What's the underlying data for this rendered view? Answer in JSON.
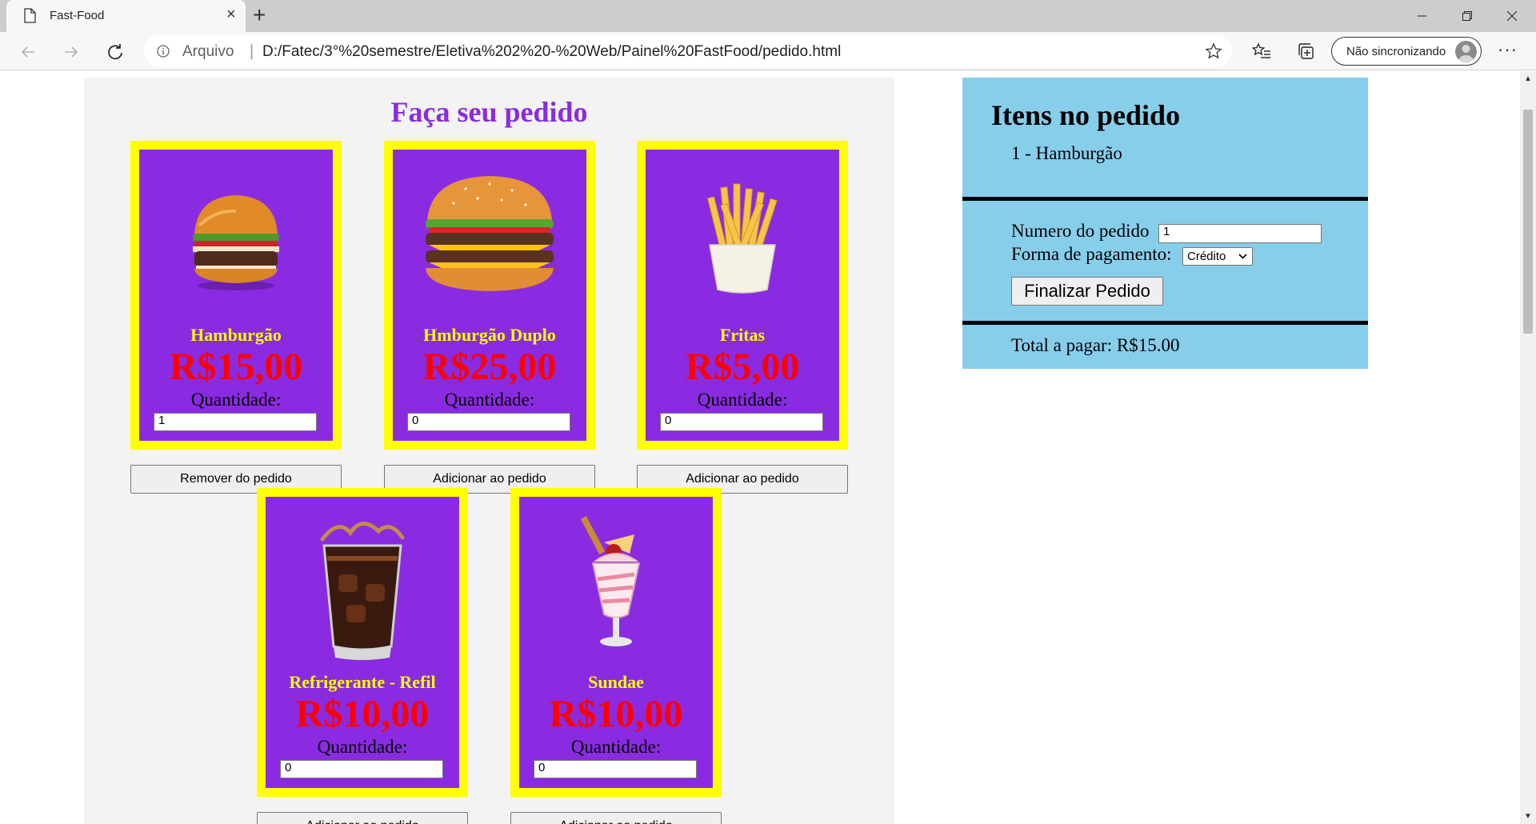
{
  "browser": {
    "tab_title": "Fast-Food",
    "address_label": "Arquivo",
    "address_separator": "|",
    "url": "D:/Fatec/3°%20semestre/Eletiva%202%20-%20Web/Painel%20FastFood/pedido.html",
    "profile_label": "Não sincronizando",
    "more_label": "···",
    "new_tab_label": "+",
    "close_tab_label": "×"
  },
  "menu": {
    "title": "Faça seu pedido",
    "quantity_label": "Quantidade:",
    "items": [
      {
        "name": "Hamburgão",
        "price": "R$15,00",
        "quantity": "1",
        "button": "Remover do pedido",
        "icon": "burger-icon"
      },
      {
        "name": "Hmburgão Duplo",
        "price": "R$25,00",
        "quantity": "0",
        "button": "Adicionar ao pedido",
        "icon": "double-burger-icon"
      },
      {
        "name": "Fritas",
        "price": "R$5,00",
        "quantity": "0",
        "button": "Adicionar ao pedido",
        "icon": "fries-icon"
      },
      {
        "name": "Refrigerante - Refil",
        "price": "R$10,00",
        "quantity": "0",
        "button": "Adicionar ao pedido",
        "icon": "soda-glass-icon"
      },
      {
        "name": "Sundae",
        "price": "R$10,00",
        "quantity": "0",
        "button": "Adicionar ao pedido",
        "icon": "sundae-icon"
      }
    ]
  },
  "order": {
    "title": "Itens no pedido",
    "items": [
      "1 - Hamburgão"
    ],
    "order_number_label": "Numero do pedido",
    "order_number_value": "1",
    "payment_label": "Forma de pagamento:",
    "payment_value": "Crédito",
    "finalize_button": "Finalizar Pedido",
    "total_text": "Total a pagar: R$15.00"
  },
  "colors": {
    "card_background": "#8a2be2",
    "card_border": "#ffff00",
    "price": "#ff0000",
    "title": "#8a2be2",
    "order_panel": "#87ceeb"
  }
}
